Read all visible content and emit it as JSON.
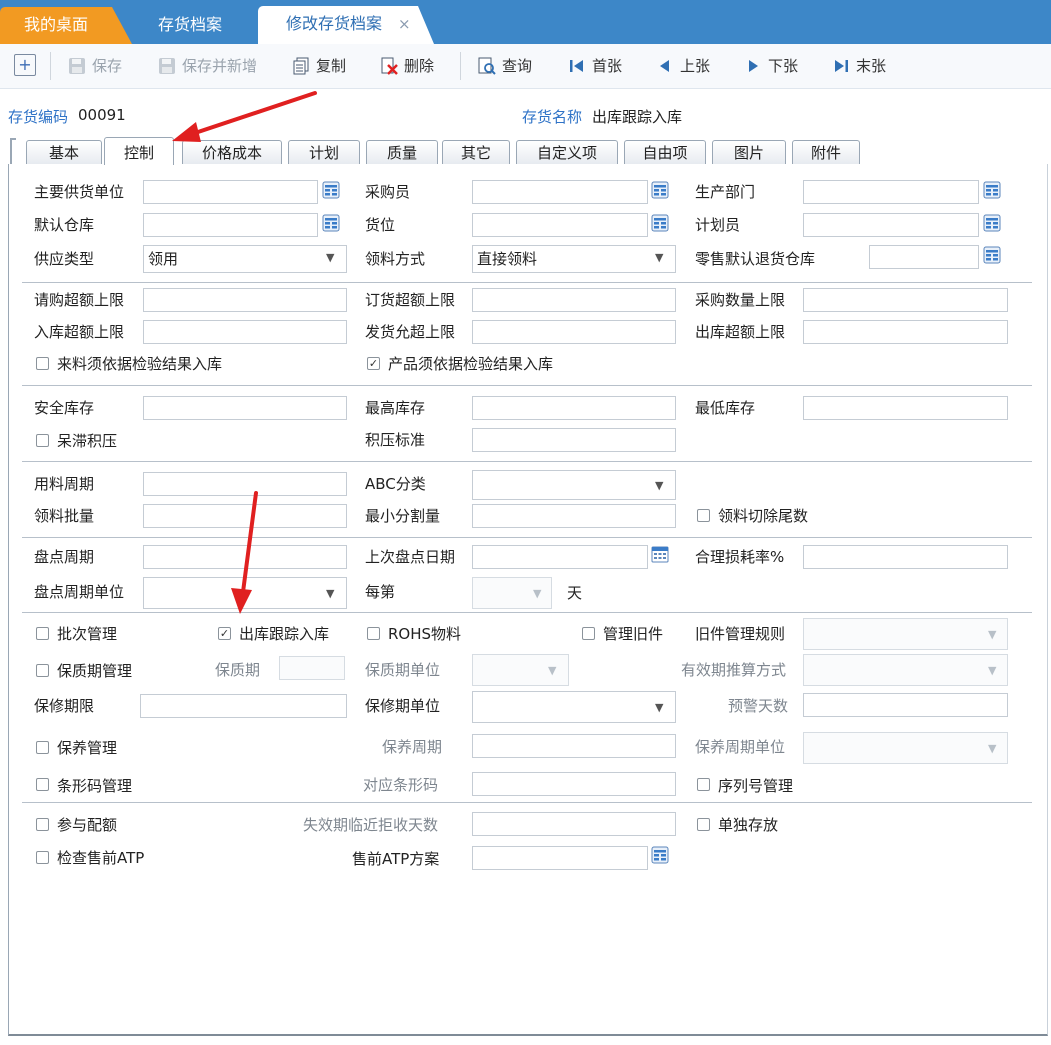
{
  "tabs": {
    "home": "我的桌面",
    "inventory": "存货档案",
    "edit": "修改存货档案",
    "close_glyph": "×"
  },
  "toolbar": {
    "save": "保存",
    "save_new": "保存并新增",
    "copy": "复制",
    "delete": "删除",
    "query": "查询",
    "first": "首张",
    "prev": "上张",
    "next": "下张",
    "last": "末张"
  },
  "header": {
    "code_label": "存货编码",
    "code_value": "00091",
    "name_label": "存货名称",
    "name_value": "出库跟踪入库"
  },
  "control_tabs": [
    "基本",
    "控制",
    "价格成本",
    "计划",
    "质量",
    "其它",
    "自定义项",
    "自由项",
    "图片",
    "附件"
  ],
  "form": {
    "main_supplier_unit": "主要供货单位",
    "buyer": "采购员",
    "production_dept": "生产部门",
    "default_warehouse": "默认仓库",
    "location": "货位",
    "planner": "计划员",
    "supply_type": "供应类型",
    "supply_type_value": "领用",
    "pick_method": "领料方式",
    "pick_method_value": "直接领料",
    "retail_return_wh": "零售默认退货仓库",
    "purchase_request_limit": "请购超额上限",
    "order_limit": "订货超额上限",
    "purchase_qty_limit": "采购数量上限",
    "inbound_limit": "入库超额上限",
    "dispatch_limit": "发货允超上限",
    "outbound_limit": "出库超额上限",
    "incoming_inspection": "来料须依据检验结果入库",
    "product_inspection": "产品须依据检验结果入库",
    "safety_stock": "安全库存",
    "max_stock": "最高库存",
    "min_stock": "最低库存",
    "stagnant": "呆滞积压",
    "stagnant_std": "积压标准",
    "usage_cycle": "用料周期",
    "abc": "ABC分类",
    "pick_batch": "领料批量",
    "min_split": "最小分割量",
    "pick_cut_tail": "领料切除尾数",
    "count_cycle": "盘点周期",
    "last_count_date": "上次盘点日期",
    "loss_rate": "合理损耗率%",
    "count_cycle_unit": "盘点周期单位",
    "every": "每第",
    "day": "天",
    "batch_mgmt": "批次管理",
    "outbound_track": "出库跟踪入库",
    "rohs": "ROHS物料",
    "old_part_mgmt": "管理旧件",
    "old_part_rule": "旧件管理规则",
    "shelf_life_mgmt": "保质期管理",
    "shelf_life": "保质期",
    "shelf_life_unit": "保质期单位",
    "expiry_method": "有效期推算方式",
    "warranty_limit": "保修期限",
    "warranty_unit": "保修期单位",
    "warning_days": "预警天数",
    "maintenance_mgmt": "保养管理",
    "maintenance_cycle": "保养周期",
    "maintenance_cycle_unit": "保养周期单位",
    "barcode_mgmt": "条形码管理",
    "barcode": "对应条形码",
    "serial_mgmt": "序列号管理",
    "quota": "参与配额",
    "expiry_reject_days": "失效期临近拒收天数",
    "separate_storage": "单独存放",
    "presale_atp": "检查售前ATP",
    "presale_atp_plan": "售前ATP方案",
    "check_glyph": "✓"
  },
  "colors": {
    "topbar": "#3d87c8",
    "home_tab": "#f29a22",
    "label_blue": "#2f73c7",
    "annotation_red": "#e02020"
  }
}
